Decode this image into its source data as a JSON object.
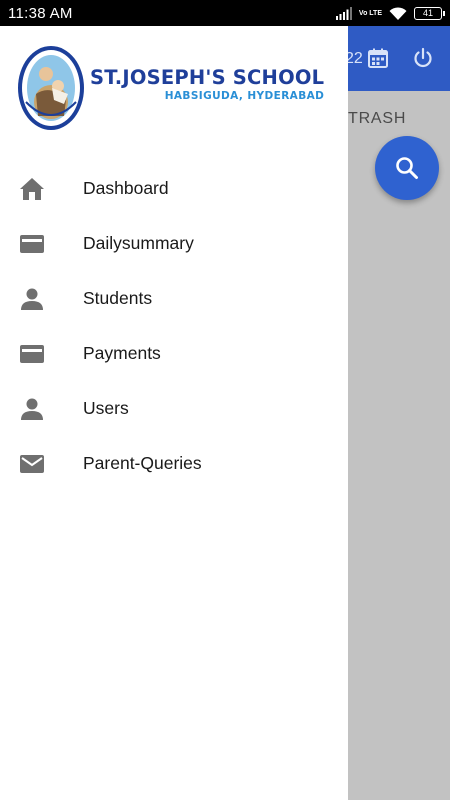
{
  "status_bar": {
    "time": "11:38 AM",
    "network": "Vo LTE",
    "battery": "41"
  },
  "background": {
    "date_fragment": "22",
    "tab_label": "TRASH"
  },
  "school": {
    "name": "ST.JOSEPH'S SCHOOL",
    "location": "HABSIGUDA, HYDERABAD"
  },
  "menu": [
    {
      "label": "Dashboard",
      "icon": "home-icon"
    },
    {
      "label": "Dailysummary",
      "icon": "credit-card-icon"
    },
    {
      "label": "Students",
      "icon": "person-icon"
    },
    {
      "label": "Payments",
      "icon": "credit-card-icon"
    },
    {
      "label": "Users",
      "icon": "person-icon"
    },
    {
      "label": "Parent-Queries",
      "icon": "mail-icon"
    }
  ],
  "colors": {
    "header": "#2f5bc4",
    "fab": "#2f62d0",
    "icon": "#6f6f6f",
    "scrim": "#c2c2c2"
  }
}
